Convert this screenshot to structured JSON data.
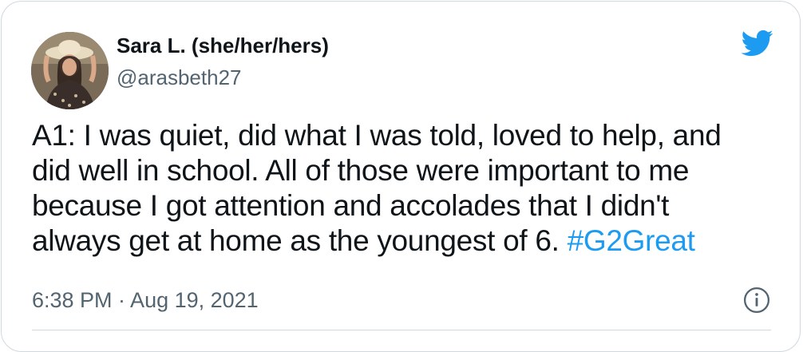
{
  "user": {
    "display_name": "Sara L. (she/her/hers)",
    "handle": "@arasbeth27"
  },
  "icons": {
    "brand": "twitter-bird-icon",
    "info": "info-icon",
    "avatar": "profile-photo"
  },
  "tweet": {
    "lines": [
      "A1: I was quiet, did what I was told, loved to help, and",
      "did well in school. All of those were important to me",
      "because I got attention and accolades that I didn't",
      "always get at home as the youngest of 6. "
    ],
    "hashtag": "#G2Great"
  },
  "meta": {
    "timestamp": "6:38 PM · Aug 19, 2021"
  },
  "colors": {
    "brand_blue": "#1d9bf0",
    "text_primary": "#0f1419",
    "text_secondary": "#536471",
    "border": "#cfd9de"
  }
}
